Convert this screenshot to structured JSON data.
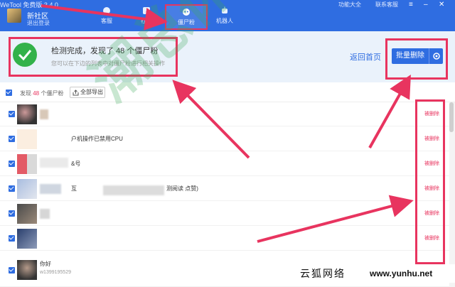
{
  "app": {
    "title": "WeTool 免费版 3.4.0"
  },
  "header": {
    "user_name": "新社区",
    "logout": "退出登录",
    "nav": [
      {
        "label": "客服",
        "icon": "headset-icon"
      },
      {
        "label": "社群",
        "icon": "group-icon"
      },
      {
        "label": "僵尸粉",
        "icon": "zombie-icon"
      },
      {
        "label": "机器人",
        "icon": "robot-icon"
      }
    ],
    "top_links": {
      "help": "功能大全",
      "contact": "联系客服"
    }
  },
  "status": {
    "title_prefix": "检测完成，发现了",
    "count": "48",
    "title_suffix": "个僵尸粉",
    "subtitle": "您可以在下边的列表中对僵尸粉进行相关操作",
    "back_home": "返回首页",
    "batch_delete": "批量删除"
  },
  "toolbar": {
    "found_prefix": "发现",
    "found_count": "48",
    "found_suffix": "个僵尸粉",
    "export_all": "全部导出"
  },
  "rows": [
    {
      "text": "",
      "delete": "被删除"
    },
    {
      "text": "户机操作已禁用CPU",
      "delete": "被删除"
    },
    {
      "text": "&号",
      "delete": "被删除"
    },
    {
      "text": "互",
      "extra": "测阅读 点赞)",
      "delete": "被删除"
    },
    {
      "text": "",
      "delete": "被删除"
    },
    {
      "text": "",
      "delete": "被删除"
    },
    {
      "text": "你好",
      "id": "w1399195529",
      "delete": ""
    }
  ],
  "watermark": "潮总休闲阁",
  "site": {
    "name": "云狐网络",
    "url": "www.yunhu.net"
  },
  "colors": {
    "brand": "#2f6de1",
    "highlight": "#e8345f",
    "success": "#33b24a"
  }
}
